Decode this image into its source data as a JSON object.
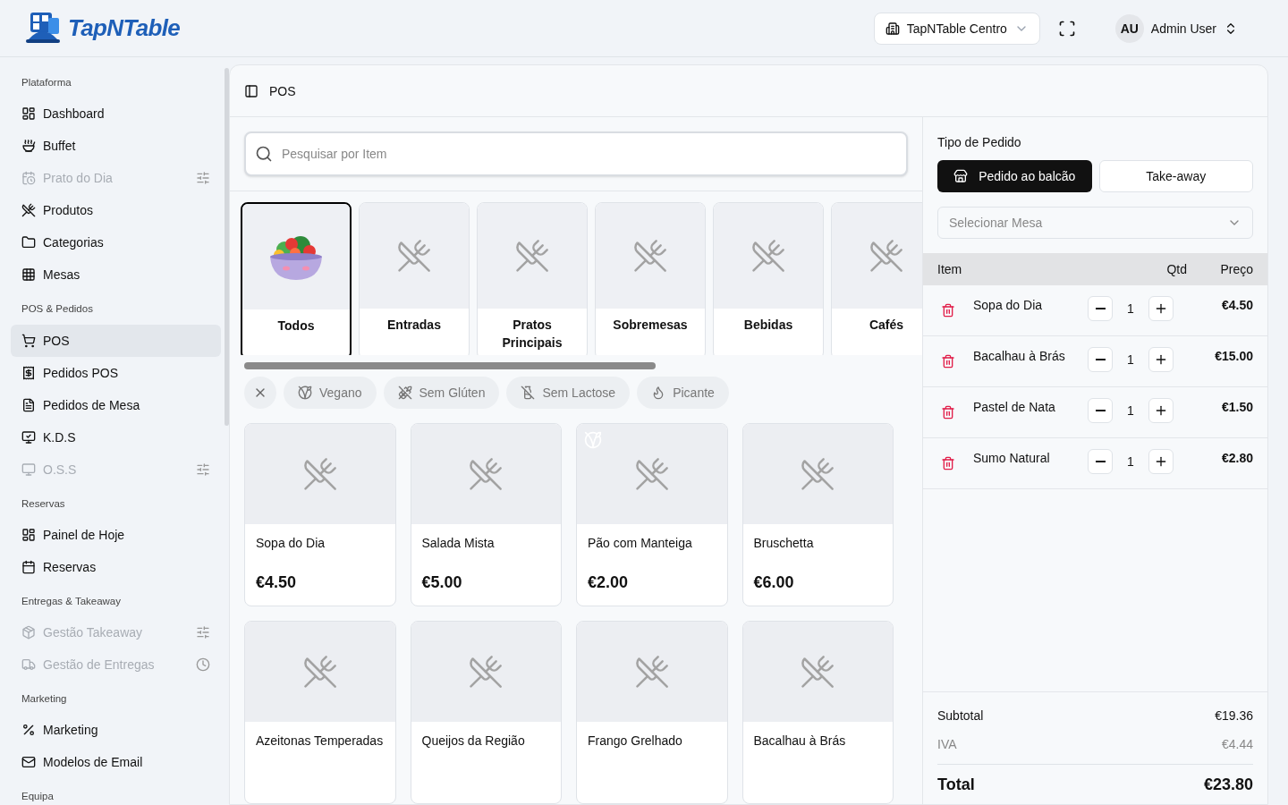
{
  "header": {
    "logo": "TapNTable",
    "location": "TapNTable Centro",
    "user_initials": "AU",
    "user_name": "Admin User"
  },
  "sidebar": {
    "sections": [
      {
        "title": "Plataforma",
        "items": [
          {
            "label": "Dashboard",
            "disabled": false,
            "selected": false
          },
          {
            "label": "Buffet",
            "disabled": false,
            "selected": false
          },
          {
            "label": "Prato do Dia",
            "disabled": true,
            "selected": false
          },
          {
            "label": "Produtos",
            "disabled": false,
            "selected": false
          },
          {
            "label": "Categorias",
            "disabled": false,
            "selected": false
          },
          {
            "label": "Mesas",
            "disabled": false,
            "selected": false
          }
        ]
      },
      {
        "title": "POS & Pedidos",
        "items": [
          {
            "label": "POS",
            "disabled": false,
            "selected": true
          },
          {
            "label": "Pedidos POS",
            "disabled": false,
            "selected": false
          },
          {
            "label": "Pedidos de Mesa",
            "disabled": false,
            "selected": false
          },
          {
            "label": "K.D.S",
            "disabled": false,
            "selected": false
          },
          {
            "label": "O.S.S",
            "disabled": true,
            "selected": false
          }
        ]
      },
      {
        "title": "Reservas",
        "items": [
          {
            "label": "Painel de Hoje",
            "disabled": false,
            "selected": false
          },
          {
            "label": "Reservas",
            "disabled": false,
            "selected": false
          }
        ]
      },
      {
        "title": "Entregas & Takeaway",
        "items": [
          {
            "label": "Gestão Takeaway",
            "disabled": true,
            "selected": false
          },
          {
            "label": "Gestão de Entregas",
            "disabled": true,
            "selected": false
          }
        ]
      },
      {
        "title": "Marketing",
        "items": [
          {
            "label": "Marketing",
            "disabled": false,
            "selected": false
          },
          {
            "label": "Modelos de Email",
            "disabled": false,
            "selected": false
          }
        ]
      },
      {
        "title": "Equipa"
      }
    ]
  },
  "page": {
    "title": "POS"
  },
  "search": {
    "placeholder": "Pesquisar por Item"
  },
  "categories": [
    {
      "label": "Todos",
      "selected": true,
      "kind": "picture"
    },
    {
      "label": "Entradas",
      "selected": false
    },
    {
      "label": "Pratos Principais",
      "selected": false
    },
    {
      "label": "Sobremesas",
      "selected": false
    },
    {
      "label": "Bebidas",
      "selected": false
    },
    {
      "label": "Cafés",
      "selected": false
    }
  ],
  "filters": [
    "Vegano",
    "Sem Glúten",
    "Sem Lactose",
    "Picante"
  ],
  "products": [
    {
      "name": "Sopa do Dia",
      "price": "€4.50",
      "vegan": false
    },
    {
      "name": "Salada Mista",
      "price": "€5.00",
      "vegan": false
    },
    {
      "name": "Pão com Manteiga",
      "price": "€2.00",
      "vegan": true
    },
    {
      "name": "Bruschetta",
      "price": "€6.00",
      "vegan": false
    },
    {
      "name": "Azeitonas Temperadas",
      "vegan": false
    },
    {
      "name": "Queijos da Região",
      "vegan": false
    },
    {
      "name": "Frango Grelhado",
      "vegan": false
    },
    {
      "name": "Bacalhau à Brás",
      "vegan": false
    }
  ],
  "order": {
    "type_label": "Tipo de Pedido",
    "types": [
      {
        "label": "Pedido ao balcão",
        "selected": true
      },
      {
        "label": "Take-away",
        "selected": false
      }
    ],
    "table_placeholder": "Selecionar Mesa",
    "columns": [
      "Item",
      "Qtd",
      "Preço"
    ],
    "items": [
      {
        "name": "Sopa do Dia",
        "qty": "1",
        "price": "€4.50"
      },
      {
        "name": "Bacalhau à Brás",
        "qty": "1",
        "price": "€15.00"
      },
      {
        "name": "Pastel de Nata",
        "qty": "1",
        "price": "€1.50"
      },
      {
        "name": "Sumo Natural",
        "qty": "1",
        "price": "€2.80"
      }
    ],
    "subtotal_label": "Subtotal",
    "subtotal": "€19.36",
    "tax_label": "IVA",
    "tax": "€4.44",
    "total_label": "Total",
    "total": "€23.80"
  }
}
